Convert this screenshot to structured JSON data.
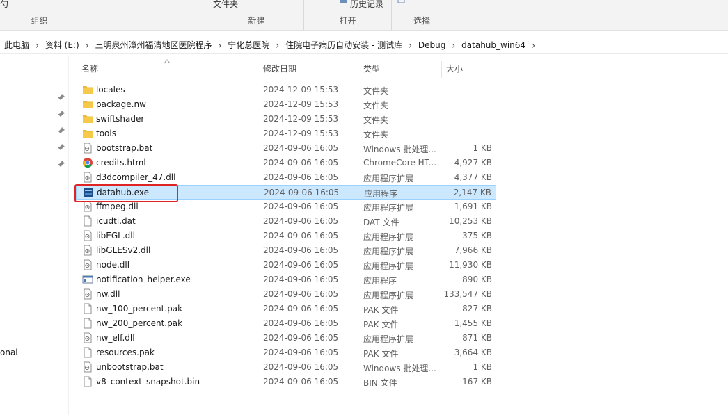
{
  "ribbon": {
    "groups": [
      {
        "label": "组织",
        "top_text": ""
      },
      {
        "label": "新建",
        "top_text": "文件夹"
      },
      {
        "label": "打开",
        "top_text": "历史记录"
      },
      {
        "label": "选择",
        "top_text": ""
      }
    ]
  },
  "breadcrumb": [
    "此电脑",
    "资料 (E:)",
    "三明泉州漳州福清地区医院程序",
    "宁化总医院",
    "住院电子病历自动安装 - 测试库",
    "Debug",
    "datahub_win64"
  ],
  "nav": {
    "partial_label": "onal"
  },
  "columns": {
    "name": "名称",
    "date": "修改日期",
    "type": "类型",
    "size": "大小"
  },
  "files": [
    {
      "name": "locales",
      "date": "2024-12-09 15:53",
      "type": "文件夹",
      "size": "",
      "icon": "folder-icon"
    },
    {
      "name": "package.nw",
      "date": "2024-12-09 15:53",
      "type": "文件夹",
      "size": "",
      "icon": "folder-icon"
    },
    {
      "name": "swiftshader",
      "date": "2024-12-09 15:53",
      "type": "文件夹",
      "size": "",
      "icon": "folder-icon"
    },
    {
      "name": "tools",
      "date": "2024-12-09 15:53",
      "type": "文件夹",
      "size": "",
      "icon": "folder-icon"
    },
    {
      "name": "bootstrap.bat",
      "date": "2024-09-06 16:05",
      "type": "Windows 批处理...",
      "size": "1 KB",
      "icon": "batch-file-icon"
    },
    {
      "name": "credits.html",
      "date": "2024-09-06 16:05",
      "type": "ChromeCore HT...",
      "size": "4,927 KB",
      "icon": "chrome-html-icon"
    },
    {
      "name": "d3dcompiler_47.dll",
      "date": "2024-09-06 16:05",
      "type": "应用程序扩展",
      "size": "4,377 KB",
      "icon": "dll-icon"
    },
    {
      "name": "datahub.exe",
      "date": "2024-09-06 16:05",
      "type": "应用程序",
      "size": "2,147 KB",
      "icon": "datahub-exe-icon"
    },
    {
      "name": "ffmpeg.dll",
      "date": "2024-09-06 16:05",
      "type": "应用程序扩展",
      "size": "1,691 KB",
      "icon": "dll-icon"
    },
    {
      "name": "icudtl.dat",
      "date": "2024-09-06 16:05",
      "type": "DAT 文件",
      "size": "10,253 KB",
      "icon": "blank-file-icon"
    },
    {
      "name": "libEGL.dll",
      "date": "2024-09-06 16:05",
      "type": "应用程序扩展",
      "size": "375 KB",
      "icon": "dll-icon"
    },
    {
      "name": "libGLESv2.dll",
      "date": "2024-09-06 16:05",
      "type": "应用程序扩展",
      "size": "7,966 KB",
      "icon": "dll-icon"
    },
    {
      "name": "node.dll",
      "date": "2024-09-06 16:05",
      "type": "应用程序扩展",
      "size": "11,930 KB",
      "icon": "dll-icon"
    },
    {
      "name": "notification_helper.exe",
      "date": "2024-09-06 16:05",
      "type": "应用程序",
      "size": "890 KB",
      "icon": "exe-window-icon"
    },
    {
      "name": "nw.dll",
      "date": "2024-09-06 16:05",
      "type": "应用程序扩展",
      "size": "133,547 KB",
      "icon": "dll-icon"
    },
    {
      "name": "nw_100_percent.pak",
      "date": "2024-09-06 16:05",
      "type": "PAK 文件",
      "size": "827 KB",
      "icon": "blank-file-icon"
    },
    {
      "name": "nw_200_percent.pak",
      "date": "2024-09-06 16:05",
      "type": "PAK 文件",
      "size": "1,455 KB",
      "icon": "blank-file-icon"
    },
    {
      "name": "nw_elf.dll",
      "date": "2024-09-06 16:05",
      "type": "应用程序扩展",
      "size": "871 KB",
      "icon": "dll-icon"
    },
    {
      "name": "resources.pak",
      "date": "2024-09-06 16:05",
      "type": "PAK 文件",
      "size": "3,664 KB",
      "icon": "blank-file-icon"
    },
    {
      "name": "unbootstrap.bat",
      "date": "2024-09-06 16:05",
      "type": "Windows 批处理...",
      "size": "1 KB",
      "icon": "batch-file-icon"
    },
    {
      "name": "v8_context_snapshot.bin",
      "date": "2024-09-06 16:05",
      "type": "BIN 文件",
      "size": "167 KB",
      "icon": "blank-file-icon"
    }
  ],
  "selected_index": 7,
  "colors": {
    "selection_bg": "#cce8ff",
    "selection_border": "#99d1ff",
    "highlight_box": "#e02424",
    "folder": "#f7c948"
  }
}
